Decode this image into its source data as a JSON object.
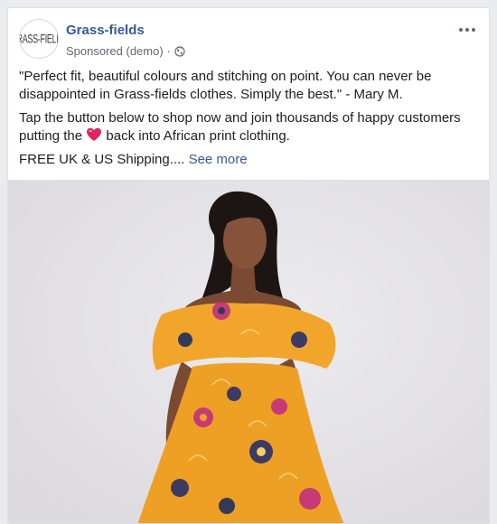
{
  "post": {
    "page_name": "Grass-fields",
    "avatar_logo_text": "GRASS-FIELDS",
    "sponsored_label": "Sponsored (demo)",
    "separator": "·",
    "quote": "\"Perfect fit, beautiful colours and stitching on point. You can never be disappointed in Grass-fields clothes. Simply the best.\" - Mary M.",
    "cta_line_part1": "Tap the button below to shop now and join thousands of happy customers putting the",
    "cta_line_part2": "back into African print clothing.",
    "shipping_text": "FREE UK & US Shipping....",
    "see_more": "See more"
  },
  "icons": {
    "privacy": "globe-icon",
    "options": "more-options-icon",
    "emoji": "red-heart-icon"
  },
  "colors": {
    "brand_link": "#385898",
    "text": "#1c1e21",
    "secondary_text": "#606770",
    "heart": "#e0245e",
    "dress": "#f1a62b",
    "background": "#e9ebee"
  }
}
